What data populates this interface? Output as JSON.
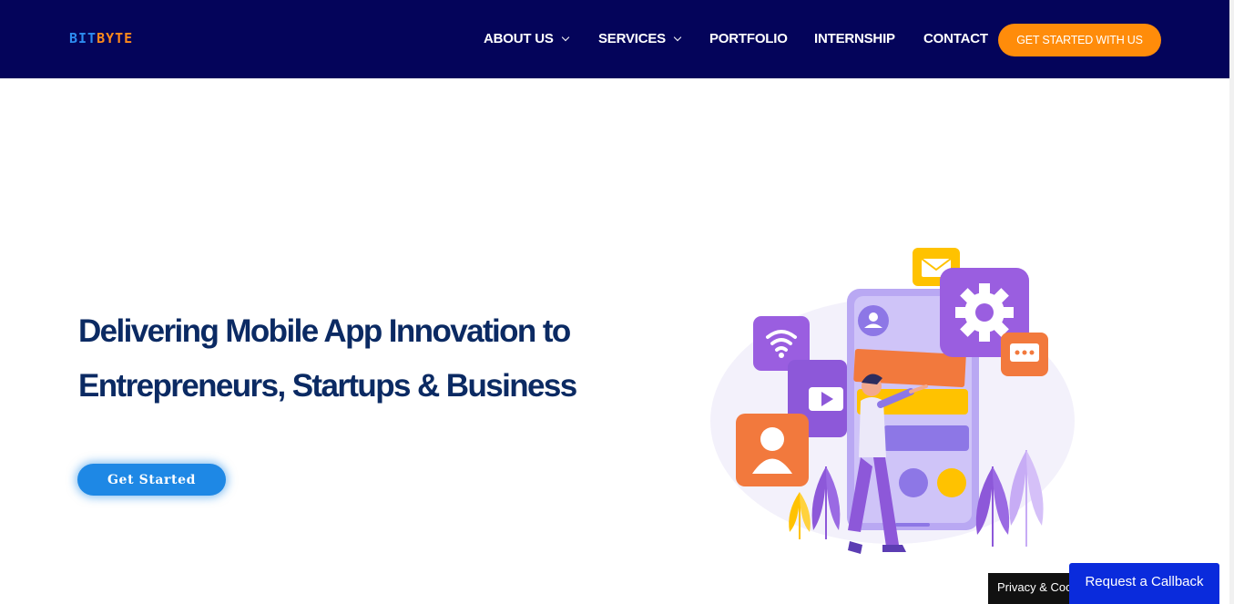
{
  "header": {
    "logo": {
      "part1": "BIT",
      "part2": "BYTE"
    },
    "nav": [
      {
        "label": "ABOUT US",
        "has_dropdown": true
      },
      {
        "label": "SERVICES",
        "has_dropdown": true
      },
      {
        "label": "PORTFOLIO",
        "has_dropdown": false
      },
      {
        "label": "INTERNSHIP",
        "has_dropdown": false
      },
      {
        "label": "CONTACT",
        "has_dropdown": false
      }
    ],
    "cta_label": "GET STARTED WITH US"
  },
  "hero": {
    "title_line1": "Delivering Mobile App Innovation to",
    "title_line2": "Entrepreneurs, Startups & Business",
    "button_label": "Get Started"
  },
  "widgets": {
    "privacy_label": "Privacy & Cookies Policy",
    "callback_label": "Request a Callback"
  },
  "colors": {
    "header_bg": "#04045a",
    "accent_orange": "#ff8c0a",
    "title_navy": "#0b2a63",
    "button_blue": "#1e88e5",
    "callback_blue": "#0a2bdc"
  }
}
